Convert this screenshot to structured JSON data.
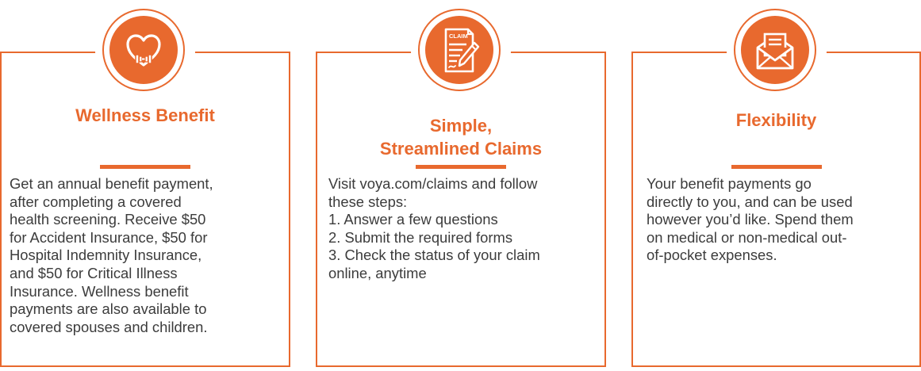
{
  "cards": [
    {
      "icon": "heart-dumbbell-icon",
      "title_lines": [
        "Wellness Benefit"
      ],
      "body_lines": [
        "Get an annual benefit payment,",
        "after completing a covered",
        "health screening. Receive $50",
        "for Accident Insurance, $50 for",
        "Hospital Indemnity Insurance,",
        "and $50 for Critical Illness",
        "Insurance. Wellness benefit",
        "payments are also available to",
        "covered spouses and children."
      ]
    },
    {
      "icon": "claim-form-icon",
      "icon_text": "CLAIM",
      "title_lines": [
        "Simple,",
        "Streamlined Claims"
      ],
      "body_lines": [
        "Visit voya.com/claims and follow",
        "these steps:",
        "1. Answer a few questions",
        "2. Submit the required forms",
        "3. Check the status of your claim",
        "online, anytime"
      ]
    },
    {
      "icon": "envelope-letter-icon",
      "title_lines": [
        "Flexibility"
      ],
      "body_lines": [
        "Your benefit payments go",
        "directly to you, and can be used",
        "however you’d like. Spend them",
        "on medical or non-medical out-",
        "of-pocket expenses."
      ]
    }
  ],
  "colors": {
    "accent": "#e8692e",
    "text": "#3c3c3c",
    "background": "#ffffff"
  }
}
